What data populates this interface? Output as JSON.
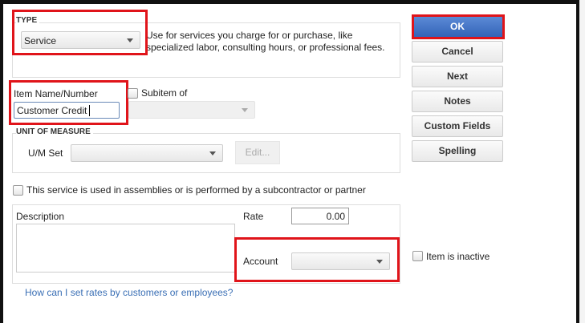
{
  "type": {
    "label": "TYPE",
    "value": "Service",
    "description": "Use for services you charge for or purchase, like specialized labor, consulting hours, or professional fees."
  },
  "item": {
    "label": "Item Name/Number",
    "value": "Customer Credit",
    "subitem_label": "Subitem of"
  },
  "uom": {
    "label": "UNIT OF MEASURE",
    "set_label": "U/M Set",
    "edit_label": "Edit..."
  },
  "assemblies_label": "This service is used in assemblies or is performed by a subcontractor or partner",
  "description_label": "Description",
  "rate": {
    "label": "Rate",
    "value": "0.00"
  },
  "account_label": "Account",
  "inactive_label": "Item is inactive",
  "help_link": "How can I set rates by customers or employees?",
  "buttons": {
    "ok": "OK",
    "cancel": "Cancel",
    "next": "Next",
    "notes": "Notes",
    "custom_fields": "Custom Fields",
    "spelling": "Spelling"
  }
}
